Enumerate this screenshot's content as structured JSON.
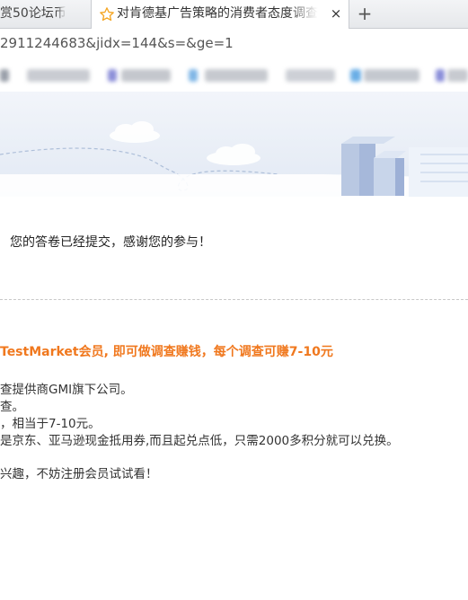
{
  "tabs": [
    {
      "label": "赏50论坛币",
      "active": false
    },
    {
      "label": "对肯德基广告策略的消费者态度调查",
      "active": true
    }
  ],
  "new_tab_symbol": "+",
  "close_symbol": "×",
  "address": {
    "url": "2911244683&jidx=144&s=&ge=1"
  },
  "content": {
    "thanks_message": "您的答卷已经提交，感谢您的参与！",
    "promo_heading": "TestMarket会员, 即可做调查赚钱，每个调查可赚7-10元",
    "promo_lines": [
      "查提供商GMI旗下公司。",
      "查。",
      "，相当于7-10元。",
      "是京东、亚马逊现金抵用券,而且起兑点低，只需2000多积分就可以兑换。"
    ],
    "promo_footer": "兴趣，不妨注册会员试试看！"
  },
  "colors": {
    "accent_orange": "#f0781e",
    "banner_sky": "#e8eef7",
    "tab_star": "#f5a623"
  }
}
